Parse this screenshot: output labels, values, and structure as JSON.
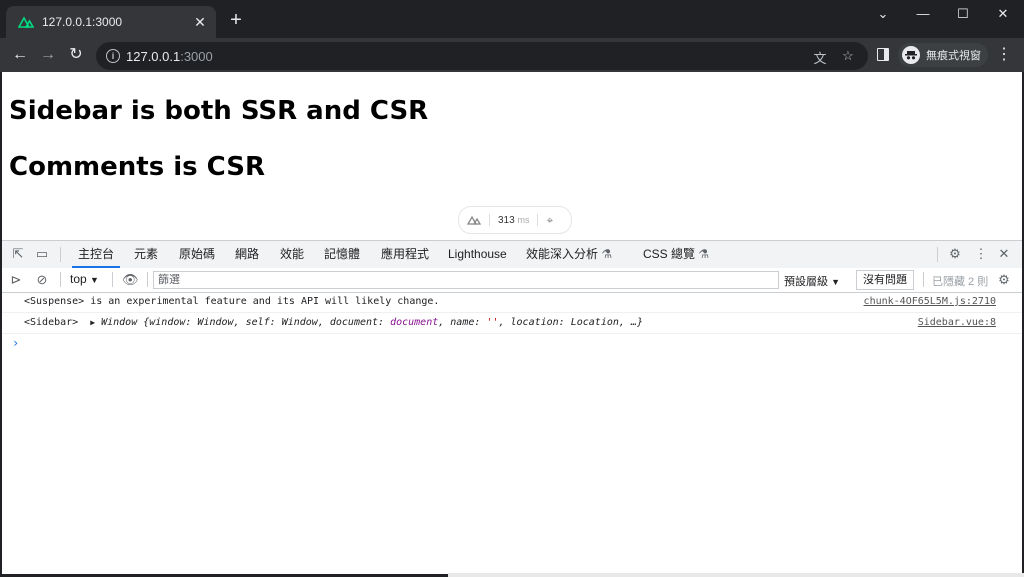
{
  "browser": {
    "tab_title": "127.0.0.1:3000",
    "url_host": "127.0.0.1",
    "url_port": ":3000",
    "profile_label": "無痕式視窗"
  },
  "page": {
    "heading1": "Sidebar is both SSR and CSR",
    "heading2": "Comments is CSR",
    "nuxt_timing": "313",
    "nuxt_unit": "ms"
  },
  "devtools": {
    "tabs": [
      "主控台",
      "元素",
      "原始碼",
      "網路",
      "效能",
      "記憶體",
      "應用程式",
      "Lighthouse",
      "效能深入分析",
      "CSS 總覽"
    ],
    "active_tab": "主控台",
    "context": "top",
    "filter_placeholder": "篩選",
    "levels_label": "預設層級",
    "issues_button": "沒有問題",
    "hidden_count": "已隱藏 2 則",
    "messages": [
      {
        "text": "<Suspense> is an experimental feature and its API will likely change.",
        "source": "chunk-4OF65L5M.js:2710"
      },
      {
        "text_prefix": "<Sidebar>",
        "source": "Sidebar.vue:8"
      }
    ]
  }
}
